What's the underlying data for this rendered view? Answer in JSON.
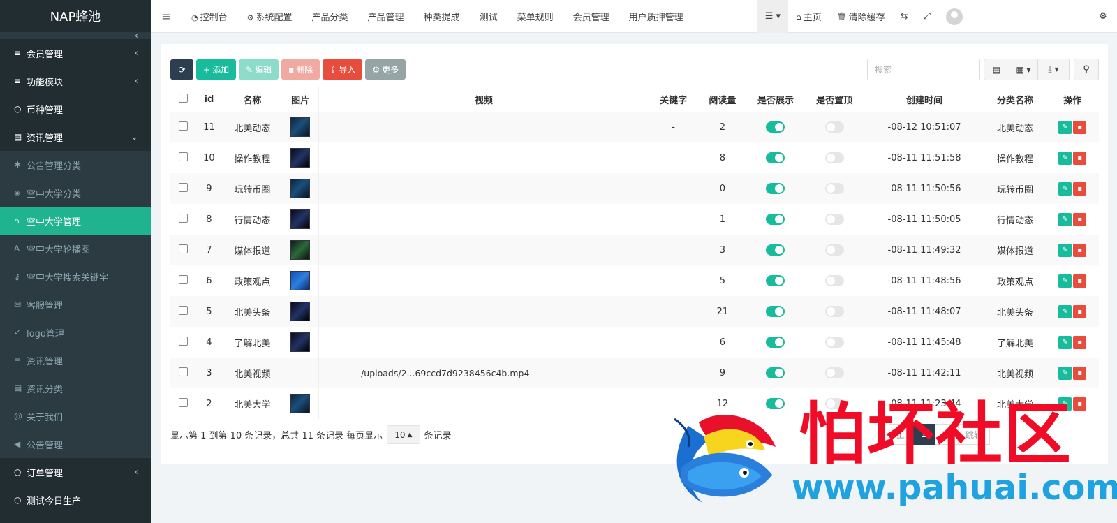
{
  "app": {
    "title": "NAP蜂池"
  },
  "sidebar": {
    "items": [
      {
        "label": "",
        "icon": "partial-icon",
        "arrow": "‹",
        "kind": "cut"
      },
      {
        "label": "会员管理",
        "icon": "list-icon",
        "arrow": "‹",
        "kind": "top"
      },
      {
        "label": "功能模块",
        "icon": "list-icon",
        "arrow": "‹",
        "kind": "top"
      },
      {
        "label": "币种管理",
        "icon": "circle-icon",
        "arrow": "",
        "kind": "top"
      },
      {
        "label": "资讯管理",
        "icon": "list-alt-icon",
        "arrow": "⌄",
        "kind": "top"
      },
      {
        "label": "公告管理分类",
        "icon": "asterisk-icon",
        "arrow": "",
        "kind": "sub"
      },
      {
        "label": "空中大学分类",
        "icon": "tags-icon",
        "arrow": "",
        "kind": "sub"
      },
      {
        "label": "空中大学管理",
        "icon": "home-icon",
        "arrow": "",
        "kind": "active"
      },
      {
        "label": "空中大学轮播图",
        "icon": "font-icon",
        "arrow": "",
        "kind": "sub"
      },
      {
        "label": "空中大学搜索关键字",
        "icon": "key-icon",
        "arrow": "",
        "kind": "sub"
      },
      {
        "label": "客服管理",
        "icon": "comments-icon",
        "arrow": "",
        "kind": "sub"
      },
      {
        "label": "logo管理",
        "icon": "check-circle-icon",
        "arrow": "",
        "kind": "sub"
      },
      {
        "label": "资讯管理",
        "icon": "list-icon",
        "arrow": "",
        "kind": "sub"
      },
      {
        "label": "资讯分类",
        "icon": "list-alt-icon",
        "arrow": "",
        "kind": "sub"
      },
      {
        "label": "关于我们",
        "icon": "at-icon",
        "arrow": "",
        "kind": "sub"
      },
      {
        "label": "公告管理",
        "icon": "bullhorn-icon",
        "arrow": "",
        "kind": "sub"
      },
      {
        "label": "订单管理",
        "icon": "circle-icon",
        "arrow": "‹",
        "kind": "top"
      },
      {
        "label": "测试今日生产",
        "icon": "circle-icon",
        "arrow": "",
        "kind": "top"
      }
    ]
  },
  "topbar": {
    "toggle_icon": "≡",
    "nav": [
      {
        "label": "控制台",
        "icon": "dashboard-icon"
      },
      {
        "label": "系统配置",
        "icon": "gear-icon"
      },
      {
        "label": "产品分类",
        "icon": ""
      },
      {
        "label": "产品管理",
        "icon": ""
      },
      {
        "label": "种类提成",
        "icon": ""
      },
      {
        "label": "测试",
        "icon": ""
      },
      {
        "label": "菜单规则",
        "icon": ""
      },
      {
        "label": "会员管理",
        "icon": ""
      },
      {
        "label": "用户质押管理",
        "icon": ""
      }
    ],
    "home_label": "主页",
    "clear_cache_label": "清除缓存"
  },
  "toolbar": {
    "add_label": "添加",
    "edit_label": "编辑",
    "delete_label": "删除",
    "import_label": "导入",
    "more_label": "更多"
  },
  "search": {
    "placeholder": "搜索"
  },
  "table": {
    "columns": [
      "id",
      "名称",
      "图片",
      "视频",
      "关键字",
      "阅读量",
      "是否展示",
      "是否置顶",
      "创建时间",
      "分类名称",
      "操作"
    ],
    "rows": [
      {
        "id": "11",
        "name": "北美动态",
        "image": "t1",
        "video": "",
        "keyword": "-",
        "reads": "2",
        "show": true,
        "top": false,
        "date_prefix": "",
        "created": "-08-12 10:51:07",
        "category": "北美动态"
      },
      {
        "id": "10",
        "name": "操作教程",
        "image": "t4",
        "video": "",
        "keyword": "",
        "reads": "8",
        "show": true,
        "top": false,
        "date_prefix": "",
        "created": "-08-11 11:51:58",
        "category": "操作教程"
      },
      {
        "id": "9",
        "name": "玩转币圈",
        "image": "t1",
        "video": "",
        "keyword": "",
        "reads": "0",
        "show": true,
        "top": false,
        "date_prefix": "",
        "created": "-08-11 11:50:56",
        "category": "玩转币圈"
      },
      {
        "id": "8",
        "name": "行情动态",
        "image": "t4",
        "video": "",
        "keyword": "",
        "reads": "1",
        "show": true,
        "top": false,
        "date_prefix": "",
        "created": "-08-11 11:50:05",
        "category": "行情动态"
      },
      {
        "id": "7",
        "name": "媒体报道",
        "image": "t2",
        "video": "",
        "keyword": "",
        "reads": "3",
        "show": true,
        "top": false,
        "date_prefix": "",
        "created": "-08-11 11:49:32",
        "category": "媒体报道"
      },
      {
        "id": "6",
        "name": "政策观点",
        "image": "t3",
        "video": "",
        "keyword": "",
        "reads": "5",
        "show": true,
        "top": false,
        "date_prefix": "",
        "created": "-08-11 11:48:56",
        "category": "政策观点"
      },
      {
        "id": "5",
        "name": "北美头条",
        "image": "t4",
        "video": "",
        "keyword": "",
        "reads": "21",
        "show": true,
        "top": false,
        "date_prefix": "",
        "created": "-08-11 11:48:07",
        "category": "北美头条"
      },
      {
        "id": "4",
        "name": "了解北美",
        "image": "t4",
        "video": "",
        "keyword": "",
        "reads": "6",
        "show": true,
        "top": false,
        "date_prefix": "",
        "created": "-08-11 11:45:48",
        "category": "了解北美"
      },
      {
        "id": "3",
        "name": "北美视频",
        "image": "",
        "video": "/uploads/2...69ccd7d9238456c4b.mp4",
        "keyword": "",
        "reads": "9",
        "show": true,
        "top": false,
        "date_prefix": "",
        "created": "-08-11 11:42:11",
        "category": "北美视频"
      },
      {
        "id": "2",
        "name": "北美大学",
        "image": "t1",
        "video": "",
        "keyword": "",
        "reads": "12",
        "show": true,
        "top": false,
        "date_prefix": "",
        "created": "-08-11 11:23:44",
        "category": "北美大学"
      }
    ]
  },
  "footer": {
    "info_prefix": "显示第 1 到第 10 条记录，总共 11 条记录 每页显示",
    "page_size": "10",
    "info_suffix": "条记录"
  },
  "pagination": {
    "prev": "上",
    "current": "1",
    "next": "页",
    "jump": "跳转"
  },
  "watermark": {
    "cn": "怕坏社区",
    "url": "www.pahuai.com"
  },
  "colors": {
    "sidebar": "#222d32",
    "accent": "#18bc9c",
    "active": "#1fb38f",
    "danger": "#e74c3c",
    "dark": "#2c3e50"
  }
}
